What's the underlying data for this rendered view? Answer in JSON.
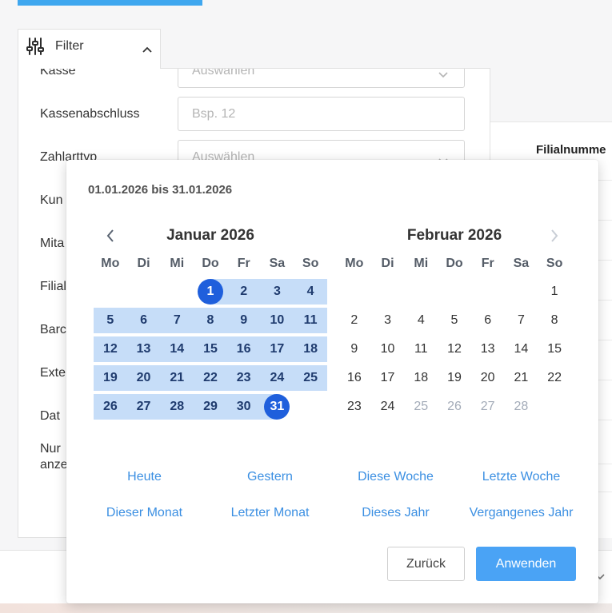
{
  "colors": {
    "top_bar": "#3fa7ef",
    "accent": "#4aa3f5",
    "selected_day": "#1f5fdc",
    "range_fill": "#c6ddf8",
    "range_text": "#1f3b6e",
    "link": "#3b8fe2",
    "disabled_day": "#a3abb8"
  },
  "icons": {
    "filter": "sliders-icon",
    "collapse": "chevron-up-icon",
    "select": "chevron-down-icon",
    "prev_month": "chevron-left-icon",
    "next_month": "chevron-right-icon"
  },
  "filter_panel": {
    "title": "Filter",
    "fields": [
      {
        "label": "Kasse",
        "placeholder": "Auswählen"
      },
      {
        "label": "Kassenabschluss",
        "placeholder": "Bsp. 12"
      },
      {
        "label": "Zahlarttyp",
        "placeholder": "Auswählen"
      },
      {
        "label": "Kun"
      },
      {
        "label": "Mita"
      },
      {
        "label": "Filial"
      },
      {
        "label": "Barc"
      },
      {
        "label": "Exte"
      },
      {
        "label": "Dat"
      },
      {
        "label_lines": [
          "Nur",
          "anze"
        ]
      }
    ]
  },
  "table": {
    "headers": [
      "Filialnumme"
    ]
  },
  "datepicker": {
    "range_text": "01.01.2026 bis 31.01.2026",
    "next_month_disabled": true,
    "weekdays": [
      "Mo",
      "Di",
      "Mi",
      "Do",
      "Fr",
      "Sa",
      "So"
    ],
    "months": [
      {
        "title": "Januar 2026",
        "weeks": [
          [
            null,
            null,
            null,
            1,
            2,
            3,
            4
          ],
          [
            5,
            6,
            7,
            8,
            9,
            10,
            11
          ],
          [
            12,
            13,
            14,
            15,
            16,
            17,
            18
          ],
          [
            19,
            20,
            21,
            22,
            23,
            24,
            25
          ],
          [
            26,
            27,
            28,
            29,
            30,
            31,
            null
          ]
        ],
        "selected_range": [
          1,
          31
        ],
        "disabled_days": []
      },
      {
        "title": "Februar 2026",
        "weeks": [
          [
            null,
            null,
            null,
            null,
            null,
            null,
            1
          ],
          [
            2,
            3,
            4,
            5,
            6,
            7,
            8
          ],
          [
            9,
            10,
            11,
            12,
            13,
            14,
            15
          ],
          [
            16,
            17,
            18,
            19,
            20,
            21,
            22
          ],
          [
            23,
            24,
            25,
            26,
            27,
            28,
            null
          ]
        ],
        "disabled_days": [
          25,
          26,
          27,
          28
        ]
      }
    ],
    "shortcuts": [
      "Heute",
      "Gestern",
      "Diese Woche",
      "Letzte Woche",
      "Dieser Monat",
      "Letzter Monat",
      "Dieses Jahr",
      "Vergangenes Jahr"
    ],
    "buttons": {
      "back": "Zurück",
      "apply": "Anwenden"
    }
  }
}
